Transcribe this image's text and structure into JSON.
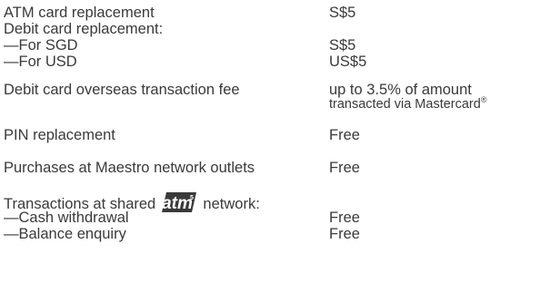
{
  "rows": {
    "atm_replacement": {
      "label": "ATM card replacement",
      "value": "S$5"
    },
    "debit_replacement": {
      "label": "Debit card replacement:"
    },
    "for_sgd": {
      "label": "—For SGD",
      "value": "S$5"
    },
    "for_usd": {
      "label": "—For USD",
      "value": "US$5"
    },
    "overseas_fee": {
      "label": "Debit card overseas transaction fee",
      "value_line1": "up to 3.5% of amount",
      "value_line2": "transacted via Mastercard",
      "value_line2_mark": "®"
    },
    "pin_replacement": {
      "label": "PIN replacement",
      "value": "Free"
    },
    "maestro": {
      "label": "Purchases at Maestro network outlets",
      "value": "Free"
    },
    "shared_network": {
      "label_before": "Transactions at shared",
      "logo_text": "atm",
      "logo_superscript": "5",
      "label_after": "network:"
    },
    "cash_withdrawal": {
      "label": "—Cash withdrawal",
      "value": "Free"
    },
    "balance_enquiry": {
      "label": "—Balance enquiry",
      "value": "Free"
    }
  },
  "logo_colors": {
    "background": "#3a3a3a",
    "text": "#ffffff"
  }
}
